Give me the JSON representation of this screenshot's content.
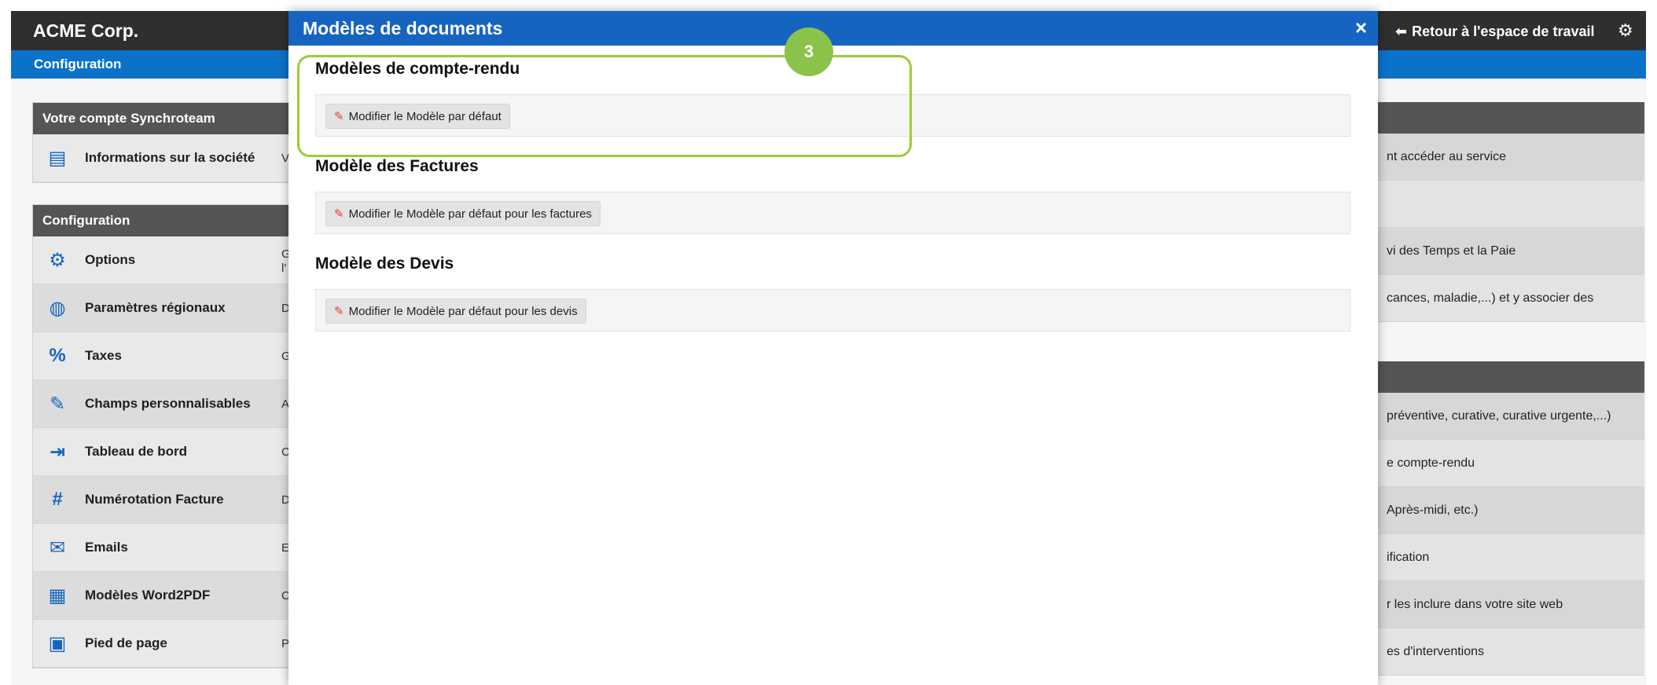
{
  "app": {
    "brand": "ACME Corp.",
    "back_link": "Retour à l'espace de travail",
    "subbar_title": "Configuration"
  },
  "account_panel": {
    "header": "Votre compte Synchroteam",
    "items": [
      {
        "icon": "id-card-icon",
        "label": "Informations sur la société",
        "desc": "V"
      }
    ]
  },
  "config_panel": {
    "header": "Configuration",
    "items": [
      {
        "icon": "gear-icon",
        "label": "Options",
        "desc": "G\nl'"
      },
      {
        "icon": "globe-icon",
        "label": "Paramètres régionaux",
        "desc": "D"
      },
      {
        "icon": "percent-icon",
        "label": "Taxes",
        "desc": "G"
      },
      {
        "icon": "edit-icon",
        "label": "Champs personnalisables",
        "desc": "A"
      },
      {
        "icon": "file-export-icon",
        "label": "Tableau de bord",
        "desc": "C"
      },
      {
        "icon": "hash-icon",
        "label": "Numérotation Facture",
        "desc": "D"
      },
      {
        "icon": "mail-icon",
        "label": "Emails",
        "desc": "E"
      },
      {
        "icon": "pdf-file-icon",
        "label": "Modèles Word2PDF",
        "desc": "C"
      },
      {
        "icon": "code-file-icon",
        "label": "Pied de page",
        "desc": "P"
      }
    ]
  },
  "right_column": {
    "panel1": [
      "nt accéder au service"
    ],
    "panel2": [
      "",
      "vi des Temps et la Paie",
      "cances, maladie,...) et y associer des"
    ],
    "panel3": [
      " préventive, curative, curative urgente,...)",
      "e compte-rendu",
      "Après-midi, etc.)",
      "ification",
      "r les inclure dans votre site web",
      "es d'interventions"
    ]
  },
  "modal": {
    "title": "Modèles de documents",
    "close": "×",
    "sections": [
      {
        "title": "Modèles de compte-rendu",
        "button": "Modifier le Modèle par défaut"
      },
      {
        "title": "Modèle des Factures",
        "button": "Modifier le Modèle par défaut pour les factures"
      },
      {
        "title": "Modèle des Devis",
        "button": "Modifier le Modèle par défaut pour les devis"
      }
    ]
  },
  "annotation": {
    "step": "3",
    "color": "#8bc34a"
  }
}
